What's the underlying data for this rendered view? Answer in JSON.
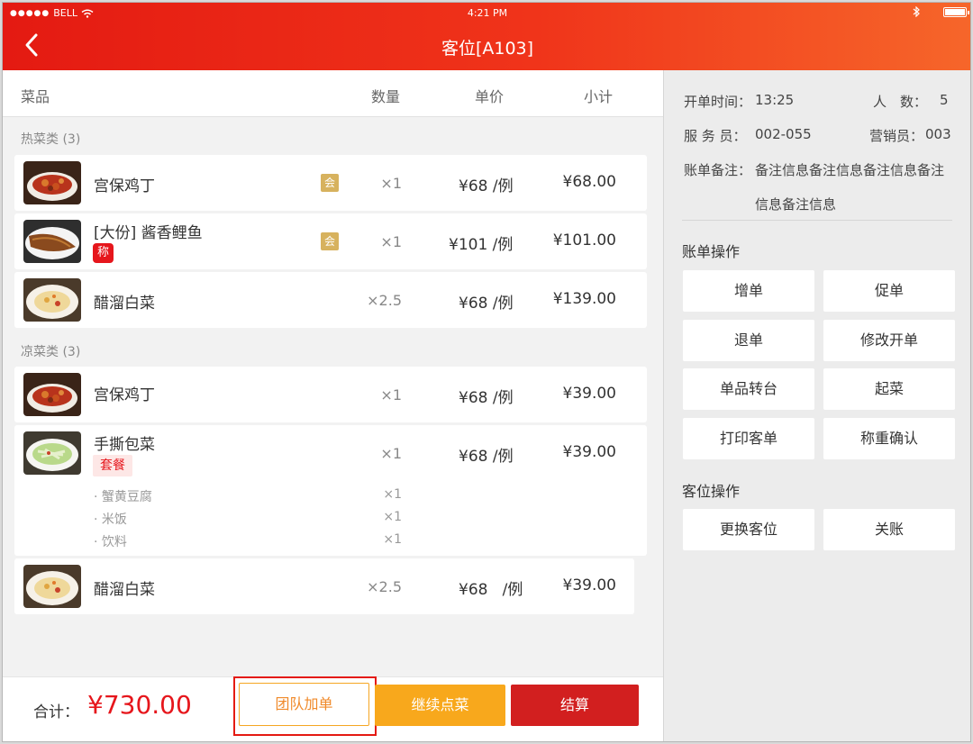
{
  "status_bar": {
    "carrier": "BELL",
    "signal_dots": "●●●●●",
    "time": "4:21 PM"
  },
  "header": {
    "title": "客位[A103]"
  },
  "columns": {
    "dish": "菜品",
    "qty": "数量",
    "unit_price": "单价",
    "subtotal": "小计"
  },
  "categories": [
    {
      "label": "热菜类 (3)"
    },
    {
      "label": "凉菜类 (3)"
    }
  ],
  "items": [
    {
      "name": "宫保鸡丁",
      "badge": "会",
      "qty": "×1",
      "price": "¥68 /例",
      "subtotal": "¥68.00"
    },
    {
      "name": "[大份] 酱香鲤鱼",
      "badge": "会",
      "tag": "称",
      "qty": "×1",
      "price": "¥101 /例",
      "subtotal": "¥101.00"
    },
    {
      "name": "醋溜白菜",
      "qty": "×2.5",
      "price": "¥68 /例",
      "subtotal": "¥139.00"
    },
    {
      "name": "宫保鸡丁",
      "qty": "×1",
      "price": "¥68 /例",
      "subtotal": "¥39.00"
    },
    {
      "name": "手撕包菜",
      "tag": "套餐",
      "qty": "×1",
      "price": "¥68 /例",
      "subtotal": "¥39.00",
      "sub_items": [
        {
          "name": "· 蟹黄豆腐",
          "qty": "×1"
        },
        {
          "name": "· 米饭",
          "qty": "×1"
        },
        {
          "name": "· 饮料",
          "qty": "×1"
        }
      ]
    },
    {
      "name": "醋溜白菜",
      "qty": "×2.5",
      "price": "¥68   /例",
      "subtotal": "¥39.00"
    }
  ],
  "footer": {
    "total_label": "合计：",
    "total_value": "¥730.00",
    "team_add": "团队加单",
    "continue_order": "继续点菜",
    "checkout": "结算"
  },
  "order_info": {
    "open_time_label": "开单时间：",
    "open_time": "13:25",
    "people_label": "人　数：",
    "people": "5",
    "waiter_label": "服 务 员：",
    "waiter": "002-055",
    "sales_label": "营销员：",
    "sales": "003",
    "remark_label": "账单备注：",
    "remark_line1": "备注信息备注信息备注信息备注",
    "remark_line2": "信息备注信息"
  },
  "bill_ops": {
    "title": "账单操作",
    "buttons": [
      "增单",
      "促单",
      "退单",
      "修改开单",
      "单品转台",
      "起菜",
      "打印客单",
      "称重确认"
    ]
  },
  "seat_ops": {
    "title": "客位操作",
    "buttons": [
      "更换客位",
      "关账"
    ]
  },
  "colors": {
    "primary_red": "#e41a12",
    "accent_orange": "#f8a81c",
    "checkout_red": "#d21f1f",
    "member_gold": "#d7b25e"
  }
}
